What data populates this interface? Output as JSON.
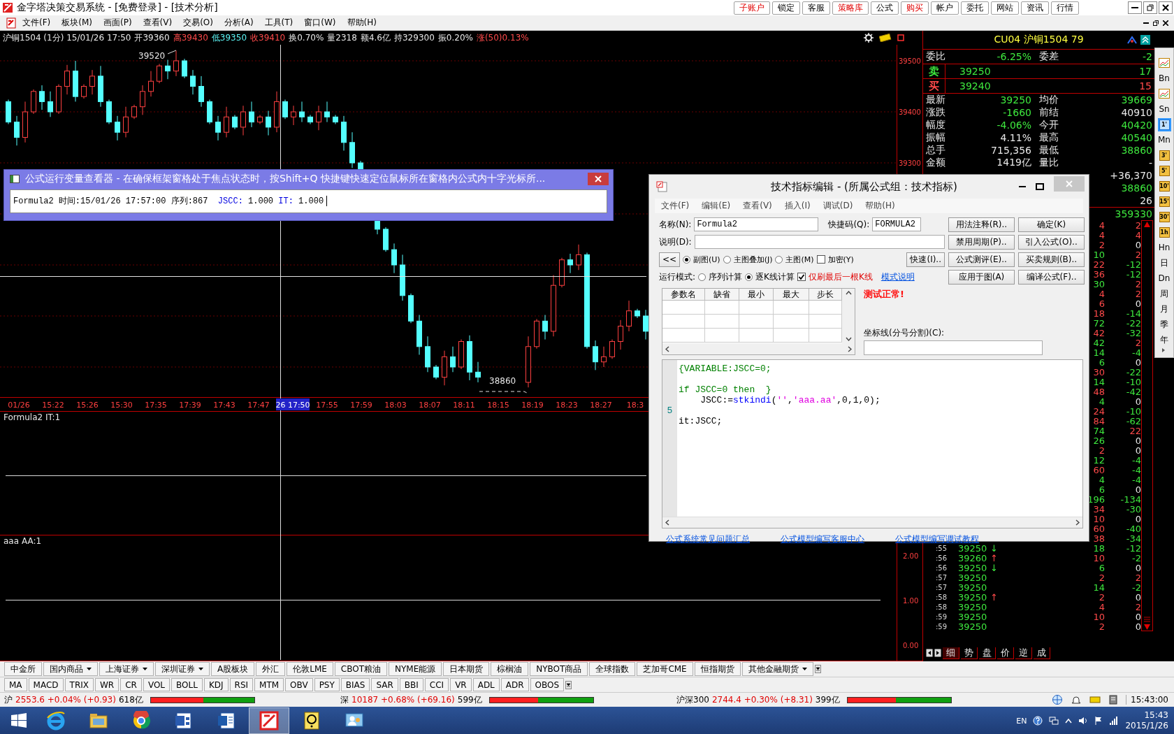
{
  "window": {
    "title": "金字塔决策交易系统 - [免费登录] - [技术分析]",
    "toolbar_buttons": [
      {
        "label": "子账户",
        "highlight": true
      },
      {
        "label": "锁定",
        "highlight": false
      },
      {
        "label": "客服",
        "highlight": false
      },
      {
        "label": "策略库",
        "highlight": true
      },
      {
        "label": "公式",
        "highlight": false
      },
      {
        "label": "购买",
        "highlight": true
      },
      {
        "label": "帐户",
        "highlight": false
      },
      {
        "label": "委托",
        "highlight": false
      },
      {
        "label": "网站",
        "highlight": false
      },
      {
        "label": "资讯",
        "highlight": false
      },
      {
        "label": "行情",
        "highlight": false
      }
    ]
  },
  "menu": [
    "文件(F)",
    "板块(M)",
    "画面(P)",
    "查看(V)",
    "交易(O)",
    "分析(A)",
    "工具(T)",
    "窗口(W)",
    "帮助(H)"
  ],
  "chart": {
    "info": [
      {
        "text": "沪铜1504 (1分) 15/01/26 17:50",
        "color": "#e8e8e8"
      },
      {
        "text": "开39360",
        "color": "#e8e8e8"
      },
      {
        "text": "高39430",
        "color": "#ff4a4a"
      },
      {
        "text": "低39350",
        "color": "#5cf5f5"
      },
      {
        "text": "收39410",
        "color": "#ff4a4a"
      },
      {
        "text": "换0.70%",
        "color": "#e8e8e8"
      },
      {
        "text": "量2318",
        "color": "#e8e8e8"
      },
      {
        "text": "额4.6亿",
        "color": "#e8e8e8"
      },
      {
        "text": "持329300",
        "color": "#e8e8e8"
      },
      {
        "text": "振0.20%",
        "color": "#e8e8e8"
      },
      {
        "text": "涨(50)0.13%",
        "color": "#ff4a4a"
      }
    ],
    "price_axis": [
      "39500",
      "39400",
      "39300"
    ],
    "high_label": "39520",
    "low_label": "38860",
    "time_axis": [
      {
        "label": "01/26",
        "selected": false
      },
      {
        "label": "15:22",
        "selected": false
      },
      {
        "label": "15:26",
        "selected": false
      },
      {
        "label": "15:30",
        "selected": false
      },
      {
        "label": "17:35",
        "selected": false
      },
      {
        "label": "17:39",
        "selected": false
      },
      {
        "label": "17:43",
        "selected": false
      },
      {
        "label": "17:47",
        "selected": false
      },
      {
        "label": "26 17:50",
        "selected": true
      },
      {
        "label": "17:55",
        "selected": false
      },
      {
        "label": "17:59",
        "selected": false
      },
      {
        "label": "18:03",
        "selected": false
      },
      {
        "label": "18:07",
        "selected": false
      },
      {
        "label": "18:11",
        "selected": false
      },
      {
        "label": "18:15",
        "selected": false
      },
      {
        "label": "18:19",
        "selected": false
      },
      {
        "label": "18:23",
        "selected": false
      },
      {
        "label": "18:27",
        "selected": false
      },
      {
        "label": "18:3",
        "selected": false
      }
    ],
    "panels": [
      {
        "title": "Formula2 IT:1"
      },
      {
        "title": "aaa AA:1",
        "axis": [
          "2.00",
          "1.00",
          "0.00"
        ]
      }
    ]
  },
  "quote": {
    "header": "CU04 沪铜1504 79",
    "ratio": {
      "label": "委比",
      "value": {
        "text": "-6.25%",
        "color": "#3ee83e"
      },
      "label2": "委差",
      "value2": {
        "text": "-2",
        "color": "#3ee83e"
      }
    },
    "book": [
      {
        "side": {
          "text": "卖",
          "color": "#3ee83e"
        },
        "price": "39250",
        "volume": {
          "text": "17",
          "color": "#3ee83e"
        }
      },
      {
        "side": {
          "text": "买",
          "color": "#ff4a4a"
        },
        "price": "39240",
        "volume": {
          "text": "15",
          "color": "#ff4a4a"
        }
      }
    ],
    "stats": [
      {
        "label": "最新",
        "value": {
          "text": "39250",
          "color": "#3ee83e"
        },
        "label2": "均价",
        "value2": {
          "text": "39669",
          "color": "#3ee83e"
        }
      },
      {
        "label": "涨跌",
        "value": {
          "text": "-1660",
          "color": "#3ee83e"
        },
        "label2": "前结",
        "value2": {
          "text": "40910",
          "color": "#e8e8e8"
        }
      },
      {
        "label": "幅度",
        "value": {
          "text": "-4.06%",
          "color": "#3ee83e"
        },
        "label2": "今开",
        "value2": {
          "text": "40420",
          "color": "#3ee83e"
        }
      },
      {
        "label": "振幅",
        "value": {
          "text": "4.11%",
          "color": "#e8e8e8"
        },
        "label2": "最高",
        "value2": {
          "text": "40540",
          "color": "#3ee83e"
        }
      },
      {
        "label": "总手",
        "value": {
          "text": "715,356",
          "color": "#e8e8e8"
        },
        "label2": "最低",
        "value2": {
          "text": "38860",
          "color": "#3ee83e"
        }
      },
      {
        "label": "金额",
        "value": {
          "text": "1419亿",
          "color": "#e8e8e8"
        },
        "label2": "量比",
        "value2": {
          "text": "-",
          "color": "#e8e8e8"
        }
      },
      {
        "value2": {
          "text": "+36,370",
          "color": "#e8e8e8"
        }
      },
      {
        "value2": {
          "text": "38860",
          "color": "#3ee83e"
        }
      },
      {
        "value2": {
          "text": "26",
          "color": "#e8e8e8"
        }
      },
      {
        "value2": {
          "text": "359330",
          "color": "#3ee83e"
        }
      }
    ],
    "ticks": [
      {
        "volume": {
          "text": "4",
          "color": "#ff4a4a"
        },
        "change": {
          "text": "2",
          "color": "#ff4a4a"
        }
      },
      {
        "volume": {
          "text": "4",
          "color": "#ff4a4a"
        },
        "change": {
          "text": "4",
          "color": "#ff4a4a"
        }
      },
      {
        "volume": {
          "text": "2",
          "color": "#ff4a4a"
        },
        "change": {
          "text": "0",
          "color": "#e8e8e8"
        }
      },
      {
        "volume": {
          "text": "10",
          "color": "#3ee83e"
        },
        "change": {
          "text": "2",
          "color": "#ff4a4a"
        }
      },
      {
        "volume": {
          "text": "22",
          "color": "#ff4a4a"
        },
        "change": {
          "text": "-12",
          "color": "#3ee83e"
        }
      },
      {
        "volume": {
          "text": "36",
          "color": "#ff4a4a"
        },
        "change": {
          "text": "-12",
          "color": "#3ee83e"
        }
      },
      {
        "volume": {
          "text": "30",
          "color": "#3ee83e"
        },
        "change": {
          "text": "2",
          "color": "#ff4a4a"
        }
      },
      {
        "volume": {
          "text": "4",
          "color": "#ff4a4a"
        },
        "change": {
          "text": "2",
          "color": "#ff4a4a"
        }
      },
      {
        "volume": {
          "text": "6",
          "color": "#ff4a4a"
        },
        "change": {
          "text": "0",
          "color": "#e8e8e8"
        }
      },
      {
        "volume": {
          "text": "18",
          "color": "#ff4a4a"
        },
        "change": {
          "text": "-14",
          "color": "#3ee83e"
        }
      },
      {
        "volume": {
          "text": "72",
          "color": "#3ee83e"
        },
        "change": {
          "text": "-22",
          "color": "#3ee83e"
        }
      },
      {
        "volume": {
          "text": "42",
          "color": "#ff4a4a"
        },
        "change": {
          "text": "-32",
          "color": "#3ee83e"
        }
      },
      {
        "volume": {
          "text": "42",
          "color": "#3ee83e"
        },
        "change": {
          "text": "2",
          "color": "#ff4a4a"
        }
      },
      {
        "volume": {
          "text": "14",
          "color": "#3ee83e"
        },
        "change": {
          "text": "-4",
          "color": "#3ee83e"
        }
      },
      {
        "volume": {
          "text": "6",
          "color": "#3ee83e"
        },
        "change": {
          "text": "0",
          "color": "#e8e8e8"
        }
      },
      {
        "volume": {
          "text": "30",
          "color": "#ff4a4a"
        },
        "change": {
          "text": "-22",
          "color": "#3ee83e"
        }
      },
      {
        "volume": {
          "text": "14",
          "color": "#3ee83e"
        },
        "change": {
          "text": "-10",
          "color": "#3ee83e"
        }
      },
      {
        "volume": {
          "text": "48",
          "color": "#ff4a4a"
        },
        "change": {
          "text": "-42",
          "color": "#3ee83e"
        }
      },
      {
        "volume": {
          "text": "4",
          "color": "#3ee83e"
        },
        "change": {
          "text": "0",
          "color": "#e8e8e8"
        }
      },
      {
        "volume": {
          "text": "24",
          "color": "#ff4a4a"
        },
        "change": {
          "text": "-10",
          "color": "#3ee83e"
        }
      },
      {
        "volume": {
          "text": "84",
          "color": "#ff4a4a"
        },
        "change": {
          "text": "-62",
          "color": "#3ee83e"
        }
      },
      {
        "volume": {
          "text": "74",
          "color": "#3ee83e"
        },
        "change": {
          "text": "22",
          "color": "#ff4a4a"
        }
      },
      {
        "volume": {
          "text": "26",
          "color": "#3ee83e"
        },
        "change": {
          "text": "0",
          "color": "#e8e8e8"
        }
      },
      {
        "volume": {
          "text": "2",
          "color": "#ff4a4a"
        },
        "change": {
          "text": "0",
          "color": "#e8e8e8"
        }
      },
      {
        "volume": {
          "text": "12",
          "color": "#3ee83e"
        },
        "change": {
          "text": "-4",
          "color": "#3ee83e"
        }
      },
      {
        "volume": {
          "text": "60",
          "color": "#ff4a4a"
        },
        "change": {
          "text": "-4",
          "color": "#3ee83e"
        }
      },
      {
        "volume": {
          "text": "4",
          "color": "#3ee83e"
        },
        "change": {
          "text": "-4",
          "color": "#3ee83e"
        }
      },
      {
        "volume": {
          "text": "6",
          "color": "#3ee83e"
        },
        "change": {
          "text": "0",
          "color": "#e8e8e8"
        }
      },
      {
        "volume": {
          "text": "196",
          "color": "#3ee83e"
        },
        "change": {
          "text": "-134",
          "color": "#3ee83e"
        }
      },
      {
        "volume": {
          "text": "34",
          "color": "#ff4a4a"
        },
        "change": {
          "text": "-30",
          "color": "#3ee83e"
        }
      },
      {
        "volume": {
          "text": "10",
          "color": "#ff4a4a"
        },
        "change": {
          "text": "0",
          "color": "#e8e8e8"
        }
      },
      {
        "volume": {
          "text": "60",
          "color": "#ff4a4a"
        },
        "change": {
          "text": "-40",
          "color": "#3ee83e"
        }
      },
      {
        "volume": {
          "text": "38",
          "color": "#ff4a4a"
        },
        "change": {
          "text": "-34",
          "color": "#3ee83e"
        }
      },
      {
        "time": ":55",
        "price": "39250",
        "arrow": {
          "text": "↓",
          "color": "#3ee83e"
        },
        "volume": {
          "text": "18",
          "color": "#3ee83e"
        },
        "change": {
          "text": "-12",
          "color": "#3ee83e"
        }
      },
      {
        "time": ":56",
        "price": "39260",
        "arrow": {
          "text": "↑",
          "color": "#ff4a4a"
        },
        "volume": {
          "text": "10",
          "color": "#ff4a4a"
        },
        "change": {
          "text": "-2",
          "color": "#3ee83e"
        }
      },
      {
        "time": ":56",
        "price": "39250",
        "arrow": {
          "text": "↓",
          "color": "#3ee83e"
        },
        "volume": {
          "text": "6",
          "color": "#3ee83e"
        },
        "change": {
          "text": "0",
          "color": "#e8e8e8"
        }
      },
      {
        "time": ":57",
        "price": "39250",
        "volume": {
          "text": "2",
          "color": "#ff4a4a"
        },
        "change": {
          "text": "2",
          "color": "#ff4a4a"
        }
      },
      {
        "time": ":57",
        "price": "39250",
        "volume": {
          "text": "14",
          "color": "#3ee83e"
        },
        "change": {
          "text": "-2",
          "color": "#3ee83e"
        }
      },
      {
        "time": ":58",
        "price": "39250",
        "arrow": {
          "text": "↑",
          "color": "#ff4a4a"
        },
        "volume": {
          "text": "2",
          "color": "#ff4a4a"
        },
        "change": {
          "text": "0",
          "color": "#e8e8e8"
        }
      },
      {
        "time": ":58",
        "price": "39250",
        "volume": {
          "text": "4",
          "color": "#ff4a4a"
        },
        "change": {
          "text": "2",
          "color": "#ff4a4a"
        }
      },
      {
        "time": ":59",
        "price": "39250",
        "volume": {
          "text": "10",
          "color": "#ff4a4a"
        },
        "change": {
          "text": "0",
          "color": "#e8e8e8"
        }
      },
      {
        "time": ":59",
        "price": "39250",
        "volume": {
          "text": "2",
          "color": "#ff4a4a"
        },
        "change": {
          "text": "0",
          "color": "#e8e8e8"
        }
      }
    ],
    "tabs": [
      {
        "label": "细",
        "selected": true
      },
      {
        "label": "势",
        "selected": false
      },
      {
        "label": "盘",
        "selected": false
      },
      {
        "label": "价",
        "selected": false
      },
      {
        "label": "逆",
        "selected": false
      },
      {
        "label": "成",
        "selected": false
      }
    ]
  },
  "side_toolbar": [
    {
      "kind": "icon",
      "selected": false
    },
    {
      "kind": "text",
      "label": "Bn",
      "selected": false
    },
    {
      "kind": "icon",
      "selected": false
    },
    {
      "kind": "text",
      "label": "Sn",
      "selected": false
    },
    {
      "kind": "badge",
      "label": "1'",
      "selected": true
    },
    {
      "kind": "text",
      "label": "Mn",
      "selected": false
    },
    {
      "kind": "badge",
      "label": "3'",
      "selected": false
    },
    {
      "kind": "badge",
      "label": "5'",
      "selected": false
    },
    {
      "kind": "badge",
      "label": "10'",
      "selected": false
    },
    {
      "kind": "badge",
      "label": "15'",
      "selected": false
    },
    {
      "kind": "badge",
      "label": "30'",
      "selected": false
    },
    {
      "kind": "badge",
      "label": "1h",
      "selected": false
    },
    {
      "kind": "text",
      "label": "Hn",
      "selected": false
    },
    {
      "kind": "text",
      "label": "日",
      "selected": false
    },
    {
      "kind": "text",
      "label": "Dn",
      "selected": false
    },
    {
      "kind": "text",
      "label": "周",
      "selected": false
    },
    {
      "kind": "text",
      "label": "月",
      "selected": false
    },
    {
      "kind": "text",
      "label": "季",
      "selected": false
    },
    {
      "kind": "text",
      "label": "年",
      "selected": false
    }
  ],
  "market_tabs": [
    {
      "label": "中金所",
      "has_menu": false,
      "selected": false
    },
    {
      "label": "国内商品",
      "has_menu": true,
      "selected": false
    },
    {
      "label": "上海证券",
      "has_menu": true,
      "selected": false
    },
    {
      "label": "深圳证券",
      "has_menu": true,
      "selected": false
    },
    {
      "label": "A股板块",
      "has_menu": false,
      "selected": false
    },
    {
      "label": "外汇",
      "has_menu": false,
      "selected": false
    },
    {
      "label": "伦敦LME",
      "has_menu": false,
      "selected": false
    },
    {
      "label": "CBOT粮油",
      "has_menu": false,
      "selected": false
    },
    {
      "label": "NYME能源",
      "has_menu": false,
      "selected": false
    },
    {
      "label": "日本期货",
      "has_menu": false,
      "selected": false
    },
    {
      "label": "棕榈油",
      "has_menu": false,
      "selected": false
    },
    {
      "label": "NYBOT商品",
      "has_menu": false,
      "selected": false
    },
    {
      "label": "全球指数",
      "has_menu": false,
      "selected": false
    },
    {
      "label": "芝加哥CME",
      "has_menu": false,
      "selected": false
    },
    {
      "label": "恒指期货",
      "has_menu": false,
      "selected": false
    },
    {
      "label": "其他金融期货",
      "has_menu": true,
      "selected": false
    }
  ],
  "indicator_tabs": [
    "MA",
    "MACD",
    "TRIX",
    "WR",
    "CR",
    "VOL",
    "BOLL",
    "KDJ",
    "RSI",
    "MTM",
    "OBV",
    "PSY",
    "BIAS",
    "SAR",
    "BBI",
    "CCI",
    "VR",
    "ADL",
    "ADR",
    "OBOS"
  ],
  "status_bar": {
    "indices": [
      {
        "name": "沪",
        "value": "2553.6 +0.04% (+0.93)",
        "amount": "618亿",
        "level": 0.51
      },
      {
        "name": "深",
        "value": "10187 +0.68% (+69.16)",
        "amount": "599亿",
        "level": 0.47
      },
      {
        "name": "沪深300",
        "value": "2744.4 +0.30% (+8.31)",
        "amount": "399亿",
        "level": 0.47
      }
    ],
    "time": "15:43:00"
  },
  "taskbar": {
    "apps": [
      {
        "kind": "browser",
        "active": false
      },
      {
        "kind": "folder",
        "active": false
      },
      {
        "kind": "globe",
        "active": false
      },
      {
        "kind": "diagram",
        "active": false
      },
      {
        "kind": "document",
        "active": false
      },
      {
        "kind": "trading",
        "active": true
      },
      {
        "kind": "help",
        "active": false
      },
      {
        "kind": "people",
        "active": false
      }
    ],
    "language": "EN",
    "time": "15:43",
    "date": "2015/1/26"
  },
  "variable_viewer": {
    "title": "公式运行变量查看器 - 在确保框架窗格处于焦点状态时，按Shift+Q 快捷键快速定位鼠标所在窗格内公式内十字光标所...",
    "line": [
      {
        "text": "Formula2 时间:15/01/26 17:57:00 序列:867  "
      },
      {
        "text": "JSCC:",
        "color": "#0000e0"
      },
      {
        "text": " 1.000 "
      },
      {
        "text": "IT:",
        "color": "#0000e0"
      },
      {
        "text": " 1.000"
      }
    ]
  },
  "editor": {
    "title": "技术指标编辑 - (所属公式组：技术指标)",
    "menu": [
      "文件(F)",
      "编辑(E)",
      "查看(V)",
      "插入(I)",
      "调试(D)",
      "帮助(H)"
    ],
    "name_label": "名称(N):",
    "name_value": "Formula2",
    "code_label": "快捷码(Q):",
    "code_value": "FORMULA2",
    "desc_label": "说明(D):",
    "buttons": [
      "用法注释(R)..",
      "确定(K)",
      "禁用周期(P)..",
      "引入公式(O)..",
      "公式测评(E)..",
      "买卖规则(B)..",
      "应用于图(A)",
      "编译公式(F).."
    ],
    "collapse_button": "<<",
    "chart_types": [
      {
        "label": "副图(U)",
        "selected": true
      },
      {
        "label": "主图叠加(J)",
        "selected": false
      },
      {
        "label": "主图(M)",
        "selected": false
      }
    ],
    "encrypt": {
      "label": "加密(Y)",
      "checked": false
    },
    "quick_button": "快速(I)..",
    "mode_label": "运行模式:",
    "modes": [
      {
        "label": "序列计算",
        "selected": false
      },
      {
        "label": "逐K线计算",
        "selected": true
      }
    ],
    "last_bar_only": {
      "label": "仅刷最后一根K线",
      "checked": true
    },
    "mode_help": "模式说明",
    "param_columns": [
      "参数名",
      "缺省",
      "最小",
      "最大",
      "步长"
    ],
    "status": "测试正常!",
    "axis_label": "坐标线(分号分割)(C):",
    "code": [
      {
        "tokens": [
          {
            "text": "{VARIABLE:JSCC=0;",
            "color": "#008000"
          }
        ]
      },
      {
        "blank": true
      },
      {
        "tokens": [
          {
            "text": "if JSCC=0 then  }",
            "color": "#008000"
          }
        ]
      },
      {
        "tokens": [
          {
            "text": "    JSCC:="
          },
          {
            "text": "stkindi",
            "color": "#0000ff"
          },
          {
            "text": "("
          },
          {
            "text": "''",
            "color": "#e000e0"
          },
          {
            "text": ","
          },
          {
            "text": "'aaa.aa'",
            "color": "#e000e0"
          },
          {
            "text": ",0,1,0);"
          }
        ]
      },
      {
        "blank": true,
        "gutter": "5"
      },
      {
        "tokens": [
          {
            "text": "it:JSCC;"
          }
        ]
      }
    ],
    "links": [
      "公式系统常见问题汇总",
      "公式模型编写客服中心",
      "公式模型编写调试教程"
    ]
  }
}
